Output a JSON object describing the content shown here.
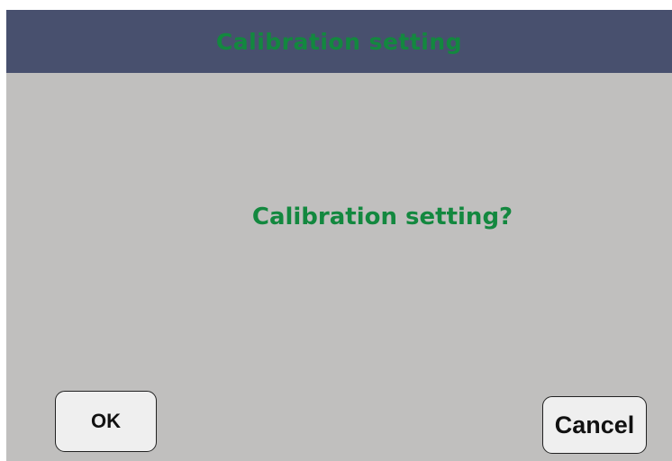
{
  "header": {
    "title": "Calibration setting"
  },
  "dialog": {
    "message": "Calibration setting?"
  },
  "buttons": {
    "ok_label": "OK",
    "cancel_label": "Cancel"
  },
  "colors": {
    "title_bar": "#48506e",
    "background": "#c0bfbe",
    "text_green": "#13883f",
    "button_fill": "#efefef"
  }
}
